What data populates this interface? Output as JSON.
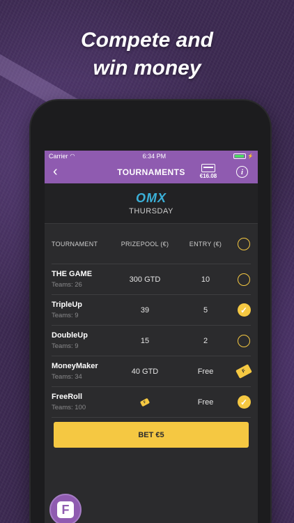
{
  "headline": {
    "line1": "Compete and",
    "line2": "win money"
  },
  "status_bar": {
    "carrier": "Carrier",
    "time": "6:34 PM"
  },
  "nav": {
    "back": "‹",
    "title": "TOURNAMENTS",
    "wallet_amount": "€16.08",
    "info": "i"
  },
  "brand": {
    "logo": "OMX",
    "subtitle": "THURSDAY"
  },
  "table": {
    "headers": {
      "tournament": "TOURNAMENT",
      "prizepool": "PRIZEPOOL (€)",
      "entry": "ENTRY (€)"
    },
    "rows": [
      {
        "name": "THE GAME",
        "teams": "Teams: 26",
        "prizepool": "300 GTD",
        "entry": "10",
        "state": "empty"
      },
      {
        "name": "TripleUp",
        "teams": "Teams: 9",
        "prizepool": "39",
        "entry": "5",
        "state": "checked"
      },
      {
        "name": "DoubleUp",
        "teams": "Teams: 9",
        "prizepool": "15",
        "entry": "2",
        "state": "empty"
      },
      {
        "name": "MoneyMaker",
        "teams": "Teams: 34",
        "prizepool": "40 GTD",
        "entry": "Free",
        "state": "ticket"
      },
      {
        "name": "FreeRoll",
        "teams": "Teams: 100",
        "prizepool": "",
        "entry": "Free",
        "state": "checked"
      }
    ]
  },
  "bet_button": {
    "label": "BET €5"
  },
  "colors": {
    "accent": "#8f5bb0",
    "yellow": "#f5c842",
    "background": "#2b2b2d"
  }
}
